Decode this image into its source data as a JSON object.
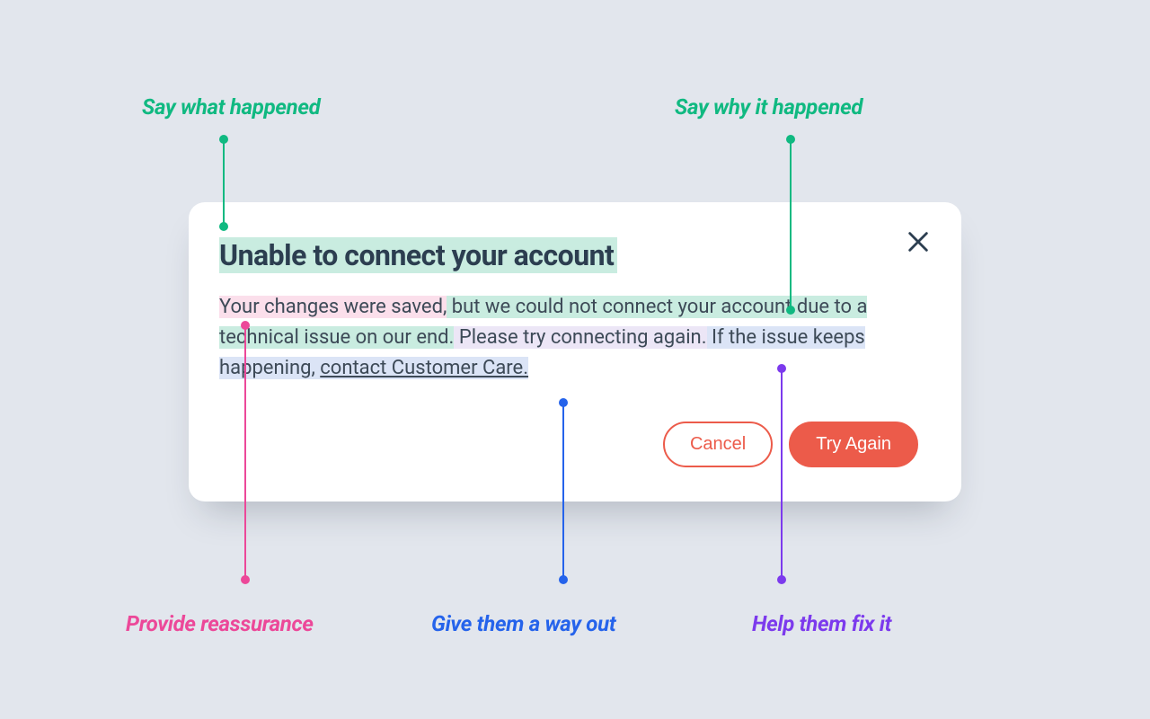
{
  "annotations": {
    "top_left": "Say what happened",
    "top_right": "Say why it happened",
    "bottom_left": "Provide reassurance",
    "bottom_center": "Give them a way out",
    "bottom_right": "Help them fix it"
  },
  "dialog": {
    "title": "Unable to connect your account",
    "body": {
      "reassurance": "Your changes were saved,",
      "why_part1": " but we could not connect your account due to a technical issue on our end.",
      "fix_it": " Please try connecting again.",
      "way_out_pre": " If the issue keeps happening, ",
      "way_out_link": "contact Customer Care."
    },
    "buttons": {
      "cancel": "Cancel",
      "primary": "Try Again"
    }
  },
  "colors": {
    "green": "#10b981",
    "pink": "#ec4899",
    "blue": "#2563eb",
    "purple": "#7c3aed"
  }
}
